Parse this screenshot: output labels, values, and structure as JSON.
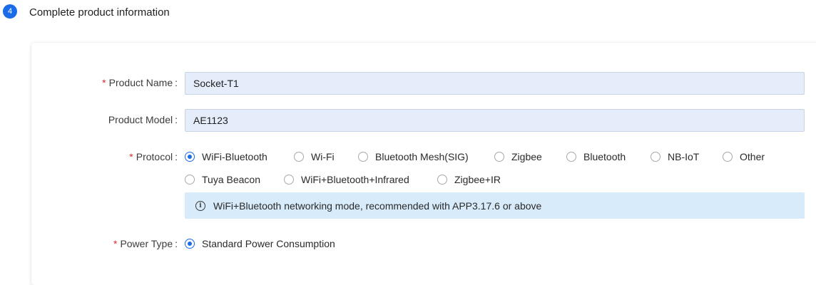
{
  "step": {
    "number": "4",
    "title": "Complete product information"
  },
  "form": {
    "product_name": {
      "label": "Product Name",
      "required": true,
      "value": "Socket-T1"
    },
    "product_model": {
      "label": "Product Model",
      "required": false,
      "value": "AE1123"
    },
    "protocol": {
      "label": "Protocol",
      "required": true,
      "selected": "WiFi-Bluetooth",
      "options": [
        "WiFi-Bluetooth",
        "Wi-Fi",
        "Bluetooth Mesh(SIG)",
        "Zigbee",
        "Bluetooth",
        "NB-IoT",
        "Other",
        "Tuya Beacon",
        "WiFi+Bluetooth+Infrared",
        "Zigbee+IR"
      ],
      "hint": "WiFi+Bluetooth networking mode, recommended with APP3.17.6 or above"
    },
    "power_type": {
      "label": "Power Type",
      "required": true,
      "selected": "Standard Power Consumption",
      "options": [
        "Standard Power Consumption"
      ]
    },
    "colon": ":",
    "required_mark": "*"
  },
  "icons": {
    "info": "info-circle-icon"
  },
  "colors": {
    "accent": "#1a6ce8",
    "required": "#e0282e",
    "input_bg": "#e5edfb",
    "info_bg": "#d8ebfa"
  }
}
